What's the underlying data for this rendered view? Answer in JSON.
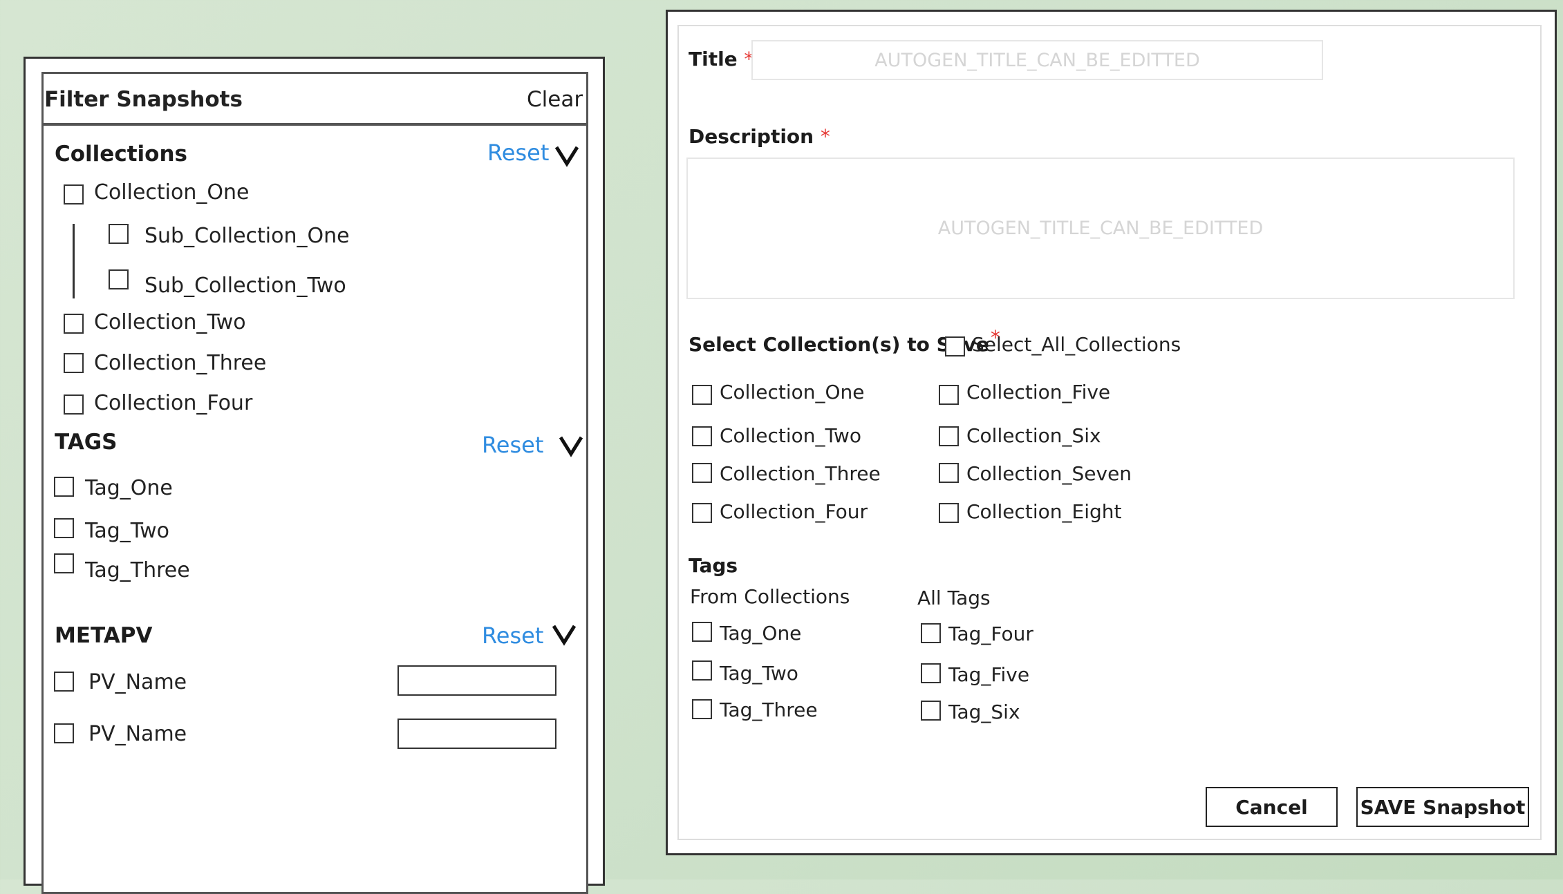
{
  "filter_panel": {
    "title": "Filter Snapshots",
    "clear_label": "Clear",
    "collections": {
      "heading": "Collections",
      "reset_label": "Reset",
      "items": [
        "Collection_One",
        "Sub_Collection_One",
        "Sub_Collection_Two",
        "Collection_Two",
        "Collection_Three",
        "Collection_Four"
      ]
    },
    "tags": {
      "heading": "TAGS",
      "reset_label": "Reset",
      "items": [
        "Tag_One",
        "Tag_Two",
        "Tag_Three"
      ]
    },
    "metapv": {
      "heading": "METAPV",
      "reset_label": "Reset",
      "items": [
        "PV_Name",
        "PV_Name"
      ]
    }
  },
  "save_form": {
    "title_label": "Title",
    "title_placeholder": "AUTOGEN_TITLE_CAN_BE_EDITTED",
    "description_label": "Description",
    "description_placeholder": "AUTOGEN_TITLE_CAN_BE_EDITTED",
    "required_mark": "*",
    "select_collections_label": "Select Collection(s) to Save",
    "select_all_label": "Select_All_Collections",
    "collections_col1": [
      "Collection_One",
      "Collection_Two",
      "Collection_Three",
      "Collection_Four"
    ],
    "collections_col2": [
      "Collection_Five",
      "Collection_Six",
      "Collection_Seven",
      "Collection_Eight"
    ],
    "tags_heading": "Tags",
    "from_collections_label": "From Collections",
    "all_tags_label": "All Tags",
    "tags_col1": [
      "Tag_One",
      "Tag_Two",
      "Tag_Three"
    ],
    "tags_col2": [
      "Tag_Four",
      "Tag_Five",
      "Tag_Six"
    ],
    "cancel_label": "Cancel",
    "save_label": "SAVE Snapshot"
  },
  "colors": {
    "accent_link": "#2f8ce0",
    "required": "#e53935",
    "background": "#d6e6d2"
  }
}
